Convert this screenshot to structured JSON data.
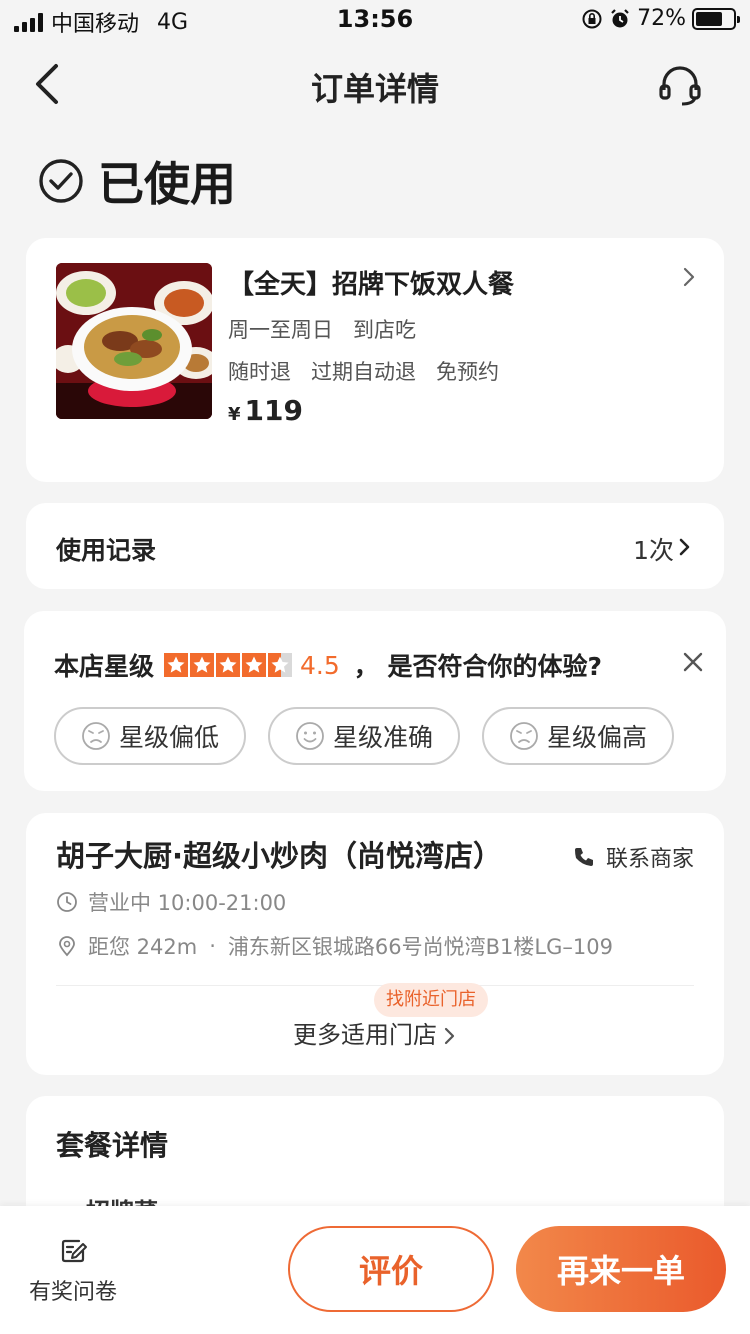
{
  "status_bar": {
    "carrier": "中国移动",
    "network": "4G",
    "time": "13:56",
    "battery": "72%",
    "battery_level": 0.72
  },
  "nav": {
    "title": "订单详情"
  },
  "order_status": {
    "text": "已使用"
  },
  "product": {
    "name": "【全天】招牌下饭双人餐",
    "schedule": "周一至周日",
    "mode": "到店吃",
    "policies": [
      "随时退",
      "过期自动退",
      "免预约"
    ],
    "currency": "¥",
    "price": "119"
  },
  "usage": {
    "label": "使用记录",
    "count": "1次"
  },
  "rating": {
    "label": "本店星级",
    "score": "4.5",
    "score_value": 4.5,
    "question": "， 是否符合你的体验?",
    "options": [
      "星级偏低",
      "星级准确",
      "星级偏高"
    ]
  },
  "store": {
    "name": "胡子大厨·超级小炒肉（尚悦湾店）",
    "contact": "联系商家",
    "hours": "营业中 10:00-21:00",
    "distance": "距您 242m",
    "address": "浦东新区银城路66号尚悦湾B1楼LG–109",
    "nearby_tag": "找附近门店",
    "more_stores": "更多适用门店"
  },
  "package": {
    "title": "套餐详情",
    "first_item": "招牌菜"
  },
  "bottom_bar": {
    "survey": "有奖问卷",
    "review": "评价",
    "reorder": "再来一单"
  },
  "colors": {
    "accent": "#f26b2c",
    "accent_dark": "#e9622b",
    "background": "#f4f4f4"
  }
}
